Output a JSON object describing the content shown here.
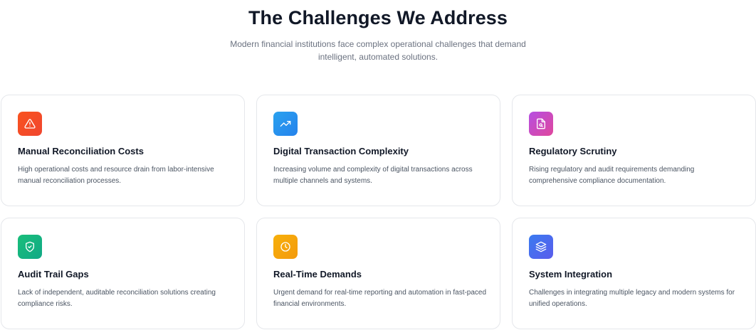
{
  "section": {
    "title": "The Challenges We Address",
    "subtitle": "Modern financial institutions face complex operational challenges that demand intelligent, automated solutions."
  },
  "cards": [
    {
      "icon": "warning-triangle-icon",
      "color_from": "#f9531f",
      "color_to": "#f0462f",
      "title": "Manual Reconciliation Costs",
      "description": "High operational costs and resource drain from labor-intensive manual reconciliation processes."
    },
    {
      "icon": "trending-up-icon",
      "color_from": "#2aa2ef",
      "color_to": "#2582ec",
      "title": "Digital Transaction Complexity",
      "description": "Increasing volume and complexity of digital transactions across multiple channels and systems."
    },
    {
      "icon": "file-search-icon",
      "color_from": "#b54fe2",
      "color_to": "#e0479c",
      "title": "Regulatory Scrutiny",
      "description": "Rising regulatory and audit requirements demanding comprehensive compliance documentation."
    },
    {
      "icon": "shield-check-icon",
      "color_from": "#19be7a",
      "color_to": "#11a986",
      "title": "Audit Trail Gaps",
      "description": "Lack of independent, auditable reconciliation solutions creating compliance risks."
    },
    {
      "icon": "clock-icon",
      "color_from": "#f7b00b",
      "color_to": "#f49a0c",
      "title": "Real-Time Demands",
      "description": "Urgent demand for real-time reporting and automation in fast-paced financial environments."
    },
    {
      "icon": "layers-icon",
      "color_from": "#3a7bf0",
      "color_to": "#5a5cec",
      "title": "System Integration",
      "description": "Challenges in integrating multiple legacy and modern systems for unified operations."
    }
  ]
}
